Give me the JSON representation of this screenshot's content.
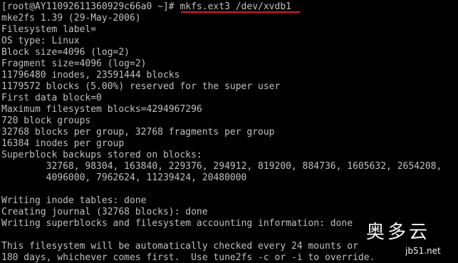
{
  "terminal": {
    "background": "#000000",
    "text_color": "#c0c0c0",
    "highlight_color": "#d21f2a",
    "prompt": "[root@AY11092611360929c66a0 ~]# ",
    "command": "mkfs.ext3 /dev/xvdb1",
    "output": [
      "mke2fs 1.39 (29-May-2006)",
      "Filesystem label=",
      "OS type: Linux",
      "Block size=4096 (log=2)",
      "Fragment size=4096 (log=2)",
      "11796480 inodes, 23591444 blocks",
      "1179572 blocks (5.00%) reserved for the super user",
      "First data block=0",
      "Maximum filesystem blocks=4294967296",
      "720 block groups",
      "32768 blocks per group, 32768 fragments per group",
      "16384 inodes per group",
      "Superblock backups stored on blocks:",
      "        32768, 98304, 163840, 229376, 294912, 819200, 884736, 1605632, 2654208,",
      "        4096000, 7962624, 11239424, 20480000",
      "",
      "Writing inode tables: done",
      "Creating journal (32768 blocks): done",
      "Writing superblocks and filesystem accounting information: done",
      "",
      "This filesystem will be automatically checked every 24 mounts or",
      "180 days, whichever comes first.  Use tune2fs -c or -i to override."
    ]
  },
  "watermark": {
    "logo_text": "奥多云",
    "site_text": "jb51.net"
  }
}
